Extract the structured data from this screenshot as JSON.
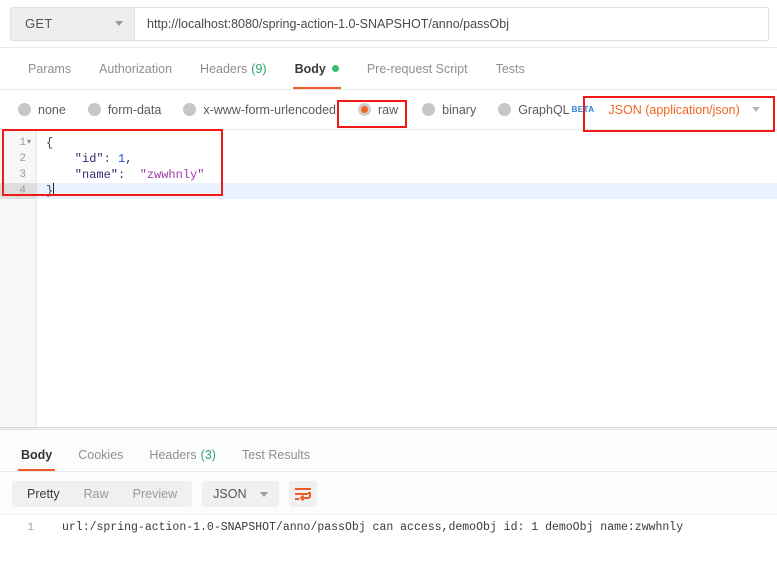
{
  "request": {
    "method": "GET",
    "url": "http://localhost:8080/spring-action-1.0-SNAPSHOT/anno/passObj",
    "tabs": [
      {
        "label": "Params",
        "count": "",
        "active": false
      },
      {
        "label": "Authorization",
        "count": "",
        "active": false
      },
      {
        "label": "Headers",
        "count": "(9)",
        "active": false
      },
      {
        "label": "Body",
        "count": "",
        "active": true
      },
      {
        "label": "Pre-request Script",
        "count": "",
        "active": false
      },
      {
        "label": "Tests",
        "count": "",
        "active": false
      }
    ],
    "body_types": [
      {
        "label": "none",
        "selected": false
      },
      {
        "label": "form-data",
        "selected": false
      },
      {
        "label": "x-www-form-urlencoded",
        "selected": false
      },
      {
        "label": "raw",
        "selected": true
      },
      {
        "label": "binary",
        "selected": false
      },
      {
        "label": "GraphQL",
        "selected": false,
        "badge": "BETA"
      }
    ],
    "content_type": "JSON (application/json)",
    "editor": {
      "lines": [
        {
          "num": "1",
          "fold": "▾",
          "active": false,
          "tokens": [
            {
              "t": "{",
              "c": "tk-brace"
            }
          ]
        },
        {
          "num": "2",
          "fold": "",
          "active": false,
          "tokens": [
            {
              "t": "    \"id\"",
              "c": "tk-key"
            },
            {
              "t": ":",
              "c": "tk-punc"
            },
            {
              "t": " 1",
              "c": "tk-num"
            },
            {
              "t": ",",
              "c": "tk-punc"
            }
          ]
        },
        {
          "num": "3",
          "fold": "",
          "active": false,
          "tokens": [
            {
              "t": "    \"name\"",
              "c": "tk-key"
            },
            {
              "t": ":",
              "c": "tk-punc"
            },
            {
              "t": "  \"zwwhnly\"",
              "c": "tk-str"
            }
          ]
        },
        {
          "num": "4",
          "fold": "",
          "active": true,
          "tokens": [
            {
              "t": "}",
              "c": "tk-brace"
            }
          ],
          "caret": true
        }
      ]
    }
  },
  "response": {
    "tabs": [
      {
        "label": "Body",
        "count": "",
        "active": true
      },
      {
        "label": "Cookies",
        "count": "",
        "active": false
      },
      {
        "label": "Headers",
        "count": "(3)",
        "active": false
      },
      {
        "label": "Test Results",
        "count": "",
        "active": false
      }
    ],
    "view_modes": [
      {
        "label": "Pretty",
        "active": true
      },
      {
        "label": "Raw",
        "active": false
      },
      {
        "label": "Preview",
        "active": false
      }
    ],
    "format": "JSON",
    "wrap_icon": "word-wrap-icon",
    "body_lines": [
      {
        "num": "1",
        "text": "url:/spring-action-1.0-SNAPSHOT/anno/passObj can access,demoObj id: 1 demoObj name:zwwhnly"
      }
    ]
  },
  "colors": {
    "accent": "#ef5b25",
    "annotation": "#f01a17",
    "green": "#3cbd6e",
    "beta_blue": "#2a7fd4"
  },
  "annotations": [
    {
      "name": "raw-option-highlight"
    },
    {
      "name": "content-type-highlight"
    },
    {
      "name": "request-body-highlight"
    }
  ]
}
